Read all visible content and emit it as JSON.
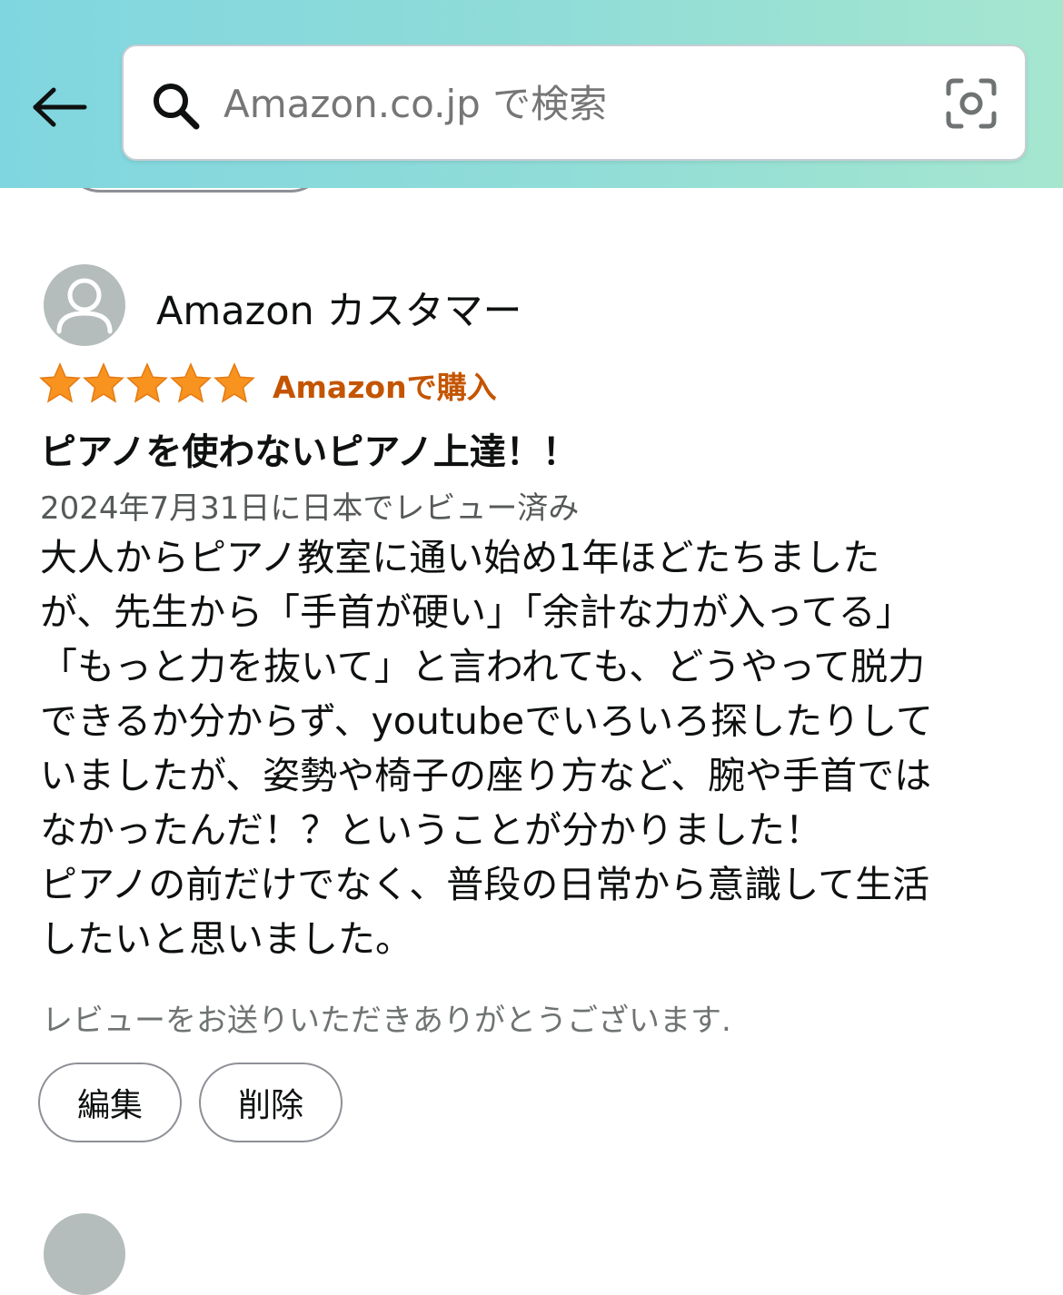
{
  "header": {
    "back_icon": "arrow-left-icon",
    "search": {
      "placeholder": "Amazon.co.jp で検索",
      "search_icon": "search-icon",
      "camera_icon": "camera-scan-icon"
    }
  },
  "review": {
    "reviewer_name": "Amazon カスタマー",
    "avatar_icon": "user-avatar-icon",
    "rating": 5,
    "rating_max": 5,
    "verified_label": "Amazonで購入",
    "title": "ピアノを使わないピアノ上達！！",
    "date": "2024年7月31日に日本でレビュー済み",
    "body_lines": [
      "大人からピアノ教室に通い始め1年ほどたちました",
      "が、先生から「手首が硬い」「余計な力が入ってる」",
      "「もっと力を抜いて」と言われても、どうやって脱力",
      "できるか分からず、youtubeでいろいろ探したりして",
      "いましたが、姿勢や椅子の座り方など、腕や手首では",
      "なかったんだ！？ということが分かりました！",
      "ピアノの前だけでなく、普段の日常から意識して生活",
      "したいと思いました。"
    ],
    "thanks_text": "レビューをお送りいただきありがとうございます.",
    "edit_label": "編集",
    "delete_label": "削除"
  },
  "colors": {
    "header_gradient_start": "#80d6e0",
    "header_gradient_end": "#a5e6cf",
    "star": "#f7931e",
    "verified": "#c45500",
    "secondary_text": "#565959"
  }
}
